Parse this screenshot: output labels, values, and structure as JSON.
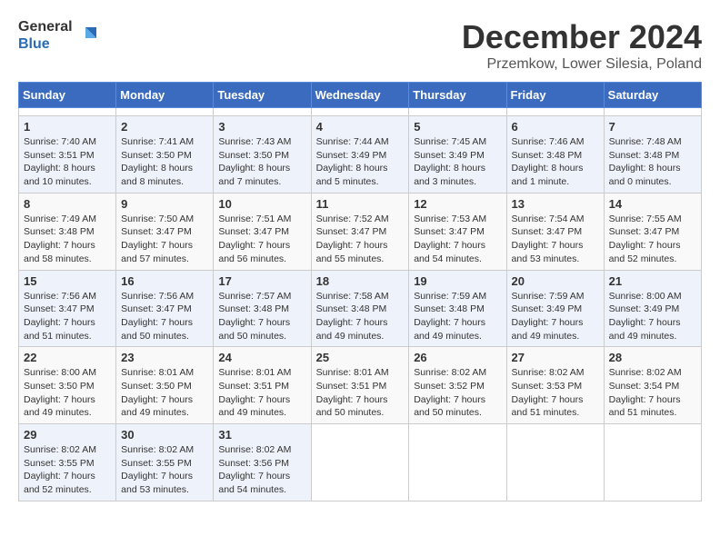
{
  "header": {
    "logo_general": "General",
    "logo_blue": "Blue",
    "title": "December 2024",
    "subtitle": "Przemkow, Lower Silesia, Poland"
  },
  "calendar": {
    "days_of_week": [
      "Sunday",
      "Monday",
      "Tuesday",
      "Wednesday",
      "Thursday",
      "Friday",
      "Saturday"
    ],
    "weeks": [
      [
        {
          "day": "",
          "info": ""
        },
        {
          "day": "",
          "info": ""
        },
        {
          "day": "",
          "info": ""
        },
        {
          "day": "",
          "info": ""
        },
        {
          "day": "",
          "info": ""
        },
        {
          "day": "",
          "info": ""
        },
        {
          "day": "",
          "info": ""
        }
      ],
      [
        {
          "day": "1",
          "sunrise": "Sunrise: 7:40 AM",
          "sunset": "Sunset: 3:51 PM",
          "daylight": "Daylight: 8 hours and 10 minutes."
        },
        {
          "day": "2",
          "sunrise": "Sunrise: 7:41 AM",
          "sunset": "Sunset: 3:50 PM",
          "daylight": "Daylight: 8 hours and 8 minutes."
        },
        {
          "day": "3",
          "sunrise": "Sunrise: 7:43 AM",
          "sunset": "Sunset: 3:50 PM",
          "daylight": "Daylight: 8 hours and 7 minutes."
        },
        {
          "day": "4",
          "sunrise": "Sunrise: 7:44 AM",
          "sunset": "Sunset: 3:49 PM",
          "daylight": "Daylight: 8 hours and 5 minutes."
        },
        {
          "day": "5",
          "sunrise": "Sunrise: 7:45 AM",
          "sunset": "Sunset: 3:49 PM",
          "daylight": "Daylight: 8 hours and 3 minutes."
        },
        {
          "day": "6",
          "sunrise": "Sunrise: 7:46 AM",
          "sunset": "Sunset: 3:48 PM",
          "daylight": "Daylight: 8 hours and 1 minute."
        },
        {
          "day": "7",
          "sunrise": "Sunrise: 7:48 AM",
          "sunset": "Sunset: 3:48 PM",
          "daylight": "Daylight: 8 hours and 0 minutes."
        }
      ],
      [
        {
          "day": "8",
          "sunrise": "Sunrise: 7:49 AM",
          "sunset": "Sunset: 3:48 PM",
          "daylight": "Daylight: 7 hours and 58 minutes."
        },
        {
          "day": "9",
          "sunrise": "Sunrise: 7:50 AM",
          "sunset": "Sunset: 3:47 PM",
          "daylight": "Daylight: 7 hours and 57 minutes."
        },
        {
          "day": "10",
          "sunrise": "Sunrise: 7:51 AM",
          "sunset": "Sunset: 3:47 PM",
          "daylight": "Daylight: 7 hours and 56 minutes."
        },
        {
          "day": "11",
          "sunrise": "Sunrise: 7:52 AM",
          "sunset": "Sunset: 3:47 PM",
          "daylight": "Daylight: 7 hours and 55 minutes."
        },
        {
          "day": "12",
          "sunrise": "Sunrise: 7:53 AM",
          "sunset": "Sunset: 3:47 PM",
          "daylight": "Daylight: 7 hours and 54 minutes."
        },
        {
          "day": "13",
          "sunrise": "Sunrise: 7:54 AM",
          "sunset": "Sunset: 3:47 PM",
          "daylight": "Daylight: 7 hours and 53 minutes."
        },
        {
          "day": "14",
          "sunrise": "Sunrise: 7:55 AM",
          "sunset": "Sunset: 3:47 PM",
          "daylight": "Daylight: 7 hours and 52 minutes."
        }
      ],
      [
        {
          "day": "15",
          "sunrise": "Sunrise: 7:56 AM",
          "sunset": "Sunset: 3:47 PM",
          "daylight": "Daylight: 7 hours and 51 minutes."
        },
        {
          "day": "16",
          "sunrise": "Sunrise: 7:56 AM",
          "sunset": "Sunset: 3:47 PM",
          "daylight": "Daylight: 7 hours and 50 minutes."
        },
        {
          "day": "17",
          "sunrise": "Sunrise: 7:57 AM",
          "sunset": "Sunset: 3:48 PM",
          "daylight": "Daylight: 7 hours and 50 minutes."
        },
        {
          "day": "18",
          "sunrise": "Sunrise: 7:58 AM",
          "sunset": "Sunset: 3:48 PM",
          "daylight": "Daylight: 7 hours and 49 minutes."
        },
        {
          "day": "19",
          "sunrise": "Sunrise: 7:59 AM",
          "sunset": "Sunset: 3:48 PM",
          "daylight": "Daylight: 7 hours and 49 minutes."
        },
        {
          "day": "20",
          "sunrise": "Sunrise: 7:59 AM",
          "sunset": "Sunset: 3:49 PM",
          "daylight": "Daylight: 7 hours and 49 minutes."
        },
        {
          "day": "21",
          "sunrise": "Sunrise: 8:00 AM",
          "sunset": "Sunset: 3:49 PM",
          "daylight": "Daylight: 7 hours and 49 minutes."
        }
      ],
      [
        {
          "day": "22",
          "sunrise": "Sunrise: 8:00 AM",
          "sunset": "Sunset: 3:50 PM",
          "daylight": "Daylight: 7 hours and 49 minutes."
        },
        {
          "day": "23",
          "sunrise": "Sunrise: 8:01 AM",
          "sunset": "Sunset: 3:50 PM",
          "daylight": "Daylight: 7 hours and 49 minutes."
        },
        {
          "day": "24",
          "sunrise": "Sunrise: 8:01 AM",
          "sunset": "Sunset: 3:51 PM",
          "daylight": "Daylight: 7 hours and 49 minutes."
        },
        {
          "day": "25",
          "sunrise": "Sunrise: 8:01 AM",
          "sunset": "Sunset: 3:51 PM",
          "daylight": "Daylight: 7 hours and 50 minutes."
        },
        {
          "day": "26",
          "sunrise": "Sunrise: 8:02 AM",
          "sunset": "Sunset: 3:52 PM",
          "daylight": "Daylight: 7 hours and 50 minutes."
        },
        {
          "day": "27",
          "sunrise": "Sunrise: 8:02 AM",
          "sunset": "Sunset: 3:53 PM",
          "daylight": "Daylight: 7 hours and 51 minutes."
        },
        {
          "day": "28",
          "sunrise": "Sunrise: 8:02 AM",
          "sunset": "Sunset: 3:54 PM",
          "daylight": "Daylight: 7 hours and 51 minutes."
        }
      ],
      [
        {
          "day": "29",
          "sunrise": "Sunrise: 8:02 AM",
          "sunset": "Sunset: 3:55 PM",
          "daylight": "Daylight: 7 hours and 52 minutes."
        },
        {
          "day": "30",
          "sunrise": "Sunrise: 8:02 AM",
          "sunset": "Sunset: 3:55 PM",
          "daylight": "Daylight: 7 hours and 53 minutes."
        },
        {
          "day": "31",
          "sunrise": "Sunrise: 8:02 AM",
          "sunset": "Sunset: 3:56 PM",
          "daylight": "Daylight: 7 hours and 54 minutes."
        },
        {
          "day": "",
          "info": ""
        },
        {
          "day": "",
          "info": ""
        },
        {
          "day": "",
          "info": ""
        },
        {
          "day": "",
          "info": ""
        }
      ]
    ]
  }
}
